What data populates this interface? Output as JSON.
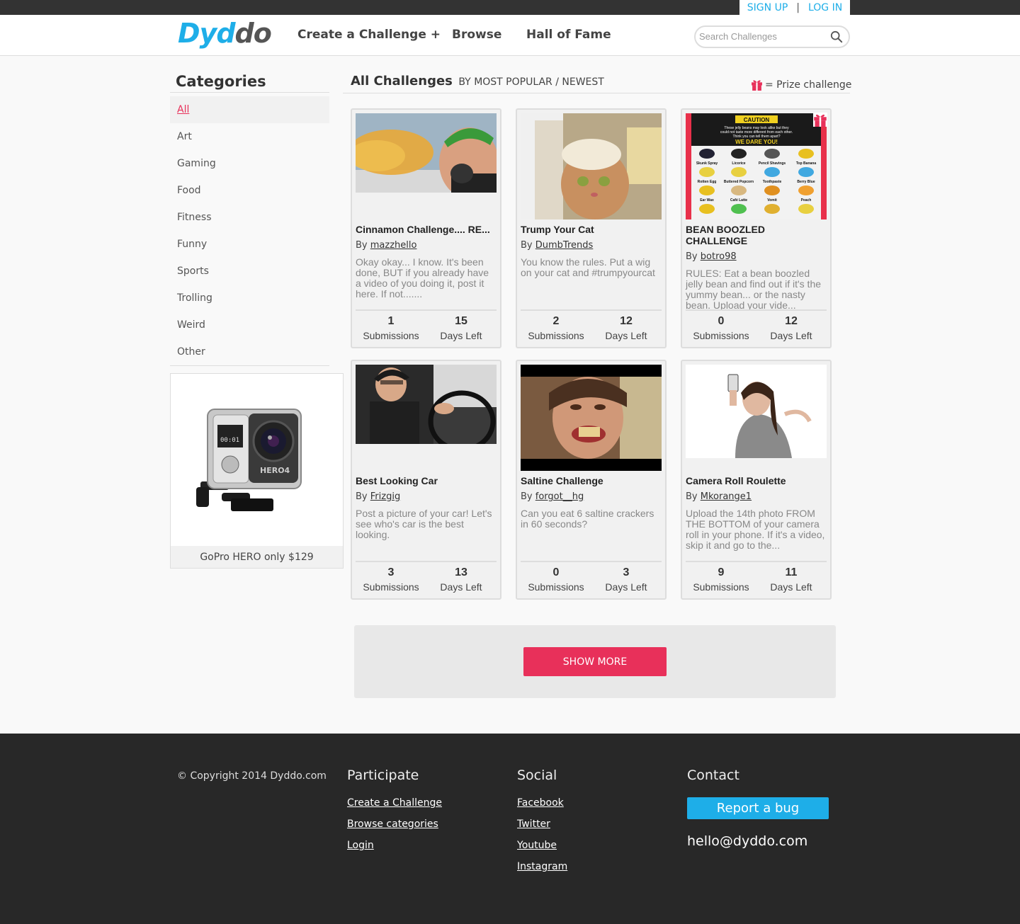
{
  "auth": {
    "signup": "SIGN UP",
    "sep": "|",
    "login": "LOG IN"
  },
  "header": {
    "logo_part1": "Dyd",
    "logo_part2": "do",
    "nav": [
      "Create a Challenge +",
      "Browse",
      "Hall of Fame"
    ],
    "search_placeholder": "Search Challenges"
  },
  "sidebar": {
    "title": "Categories",
    "categories": [
      "All",
      "Art",
      "Gaming",
      "Food",
      "Fitness",
      "Funny",
      "Sports",
      "Trolling",
      "Weird",
      "Other"
    ],
    "active": "All",
    "ad_label": "GoPro HERO only $129"
  },
  "main": {
    "title": "All Challenges",
    "by": "BY",
    "sort_popular": "MOST POPULAR",
    "sort_sep": "/",
    "sort_newest": "NEWEST",
    "prize_legend": "= Prize challenge",
    "submissions_label": "Submissions",
    "days_label": "Days Left",
    "by_label": "By",
    "show_more": "SHOW MORE"
  },
  "challenges": [
    {
      "title": "Cinnamon Challenge.... RE...",
      "author": "mazzhello",
      "desc": "Okay okay... I know. It's been done, BUT if you already have a video of you doing it, post it here. If not.......",
      "submissions": "1",
      "days_left": "15",
      "prize": false
    },
    {
      "title": "Trump Your Cat",
      "author": "DumbTrends",
      "desc": "You know the rules. Put a wig on your cat and #trumpyourcat",
      "submissions": "2",
      "days_left": "12",
      "prize": false
    },
    {
      "title": "BEAN BOOZLED CHALLENGE",
      "author": "botro98",
      "desc": "RULES: Eat a bean boozled jelly bean and find out if it's the yummy bean... or the nasty bean. Upload your vide...",
      "submissions": "0",
      "days_left": "12",
      "prize": true
    },
    {
      "title": "Best Looking Car",
      "author": "Frizgig",
      "desc": "Post a picture of your car! Let's see who's car is the best looking.",
      "submissions": "3",
      "days_left": "13",
      "prize": false
    },
    {
      "title": "Saltine Challenge",
      "author": "forgot__hg",
      "desc": "Can you eat 6 saltine crackers in 60 seconds?",
      "submissions": "0",
      "days_left": "3",
      "prize": false
    },
    {
      "title": "Camera Roll Roulette",
      "author": "Mkorange1",
      "desc": "Upload the 14th photo FROM THE BOTTOM of your camera roll in your phone. If it's a video, skip it and go to the...",
      "submissions": "9",
      "days_left": "11",
      "prize": false
    }
  ],
  "caution_sign": {
    "caution": "CAUTION",
    "line1": "These jelly beans may look alike but they",
    "line2": "could not taste more different from each other.",
    "line3": "Think you can tell them apart?",
    "dare": "WE DARE YOU!",
    "flavors": [
      "Skunk Spray",
      "Licorice",
      "Pencil Shavings",
      "Top Banana",
      "Rotten Egg",
      "Buttered Popcorn",
      "Toothpaste",
      "Berry Blue",
      "Ear Wax",
      "Café Latte",
      "Vomit",
      "Peach"
    ]
  },
  "gopro_text": {
    "screen": "00:01",
    "model": "HERO4"
  },
  "footer": {
    "copyright": "© Copyright 2014 Dyddo.com",
    "participate": {
      "title": "Participate",
      "links": [
        "Create a Challenge",
        "Browse categories",
        "Login"
      ]
    },
    "social": {
      "title": "Social",
      "links": [
        "Facebook",
        "Twitter",
        "Youtube",
        "Instagram"
      ]
    },
    "contact": {
      "title": "Contact",
      "bug_button": "Report a bug",
      "email": "hello@dyddo.com"
    }
  },
  "colors": {
    "accent_blue": "#1eaee8",
    "accent_pink": "#e8305a",
    "dark": "#282828"
  }
}
